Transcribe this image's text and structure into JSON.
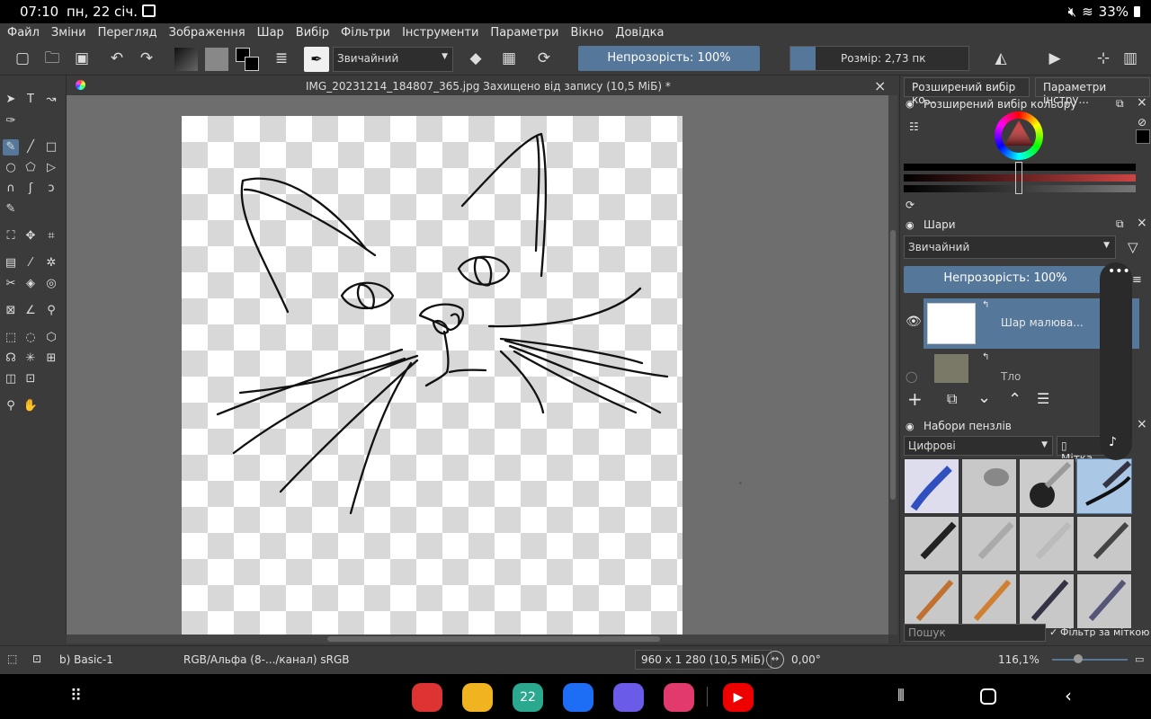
{
  "status": {
    "time": "07:10",
    "date": "пн, 22 січ.",
    "battery": "33%"
  },
  "menu": [
    "Файл",
    "Зміни",
    "Перегляд",
    "Зображення",
    "Шар",
    "Вибір",
    "Фільтри",
    "Інструменти",
    "Параметри",
    "Вікно",
    "Довідка"
  ],
  "toolbar": {
    "blend_mode": "Звичайний",
    "opacity": "Непрозорість: 100%",
    "size": "Розмір: 2,73 пк"
  },
  "document": {
    "title": "IMG_20231214_184807_365.jpg Захищено від запису  (10,5 МіБ)  *",
    "close": "×"
  },
  "dock": {
    "tab_color": "Розширений вибір ко...",
    "tab_tool": "Параметри інстру...",
    "color_panel_title": "Розширений вибір кольору",
    "layers_title": "Шари",
    "layers_blend": "Звичайний",
    "layers_opacity": "Непрозорість:  100%",
    "layers": [
      {
        "name": "Шар малюва..."
      },
      {
        "name": "Тло"
      }
    ],
    "presets_title": "Набори пензлів",
    "presets_tag": "Цифрові",
    "presets_tag_btn": "Мітка",
    "search_placeholder": "Пошук",
    "filter_label": "Фільтр за міткою"
  },
  "statusbar": {
    "brush": "b) Basic-1",
    "colorspace": "RGB/Альфа (8-.../канал)  sRGB",
    "dimensions": "960 x 1 280 (10,5 МіБ)",
    "rotation": "0,00°",
    "zoom": "116,1%"
  },
  "nav": {
    "calendar_day": "22"
  },
  "colors": {
    "accent": "#557799",
    "canvas_bg": "#6e6e6e",
    "panel": "#3b3b3b"
  }
}
